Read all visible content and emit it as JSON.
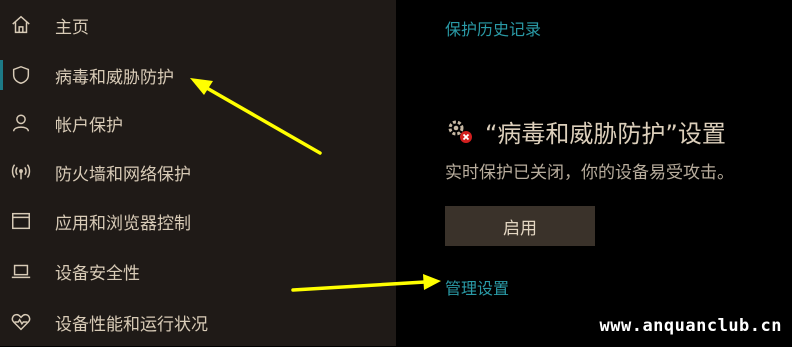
{
  "sidebar": {
    "items": [
      {
        "label": "主页",
        "icon": "home-icon"
      },
      {
        "label": "病毒和威胁防护",
        "icon": "shield-icon",
        "selected": true
      },
      {
        "label": "帐户保护",
        "icon": "person-icon"
      },
      {
        "label": "防火墙和网络保护",
        "icon": "wifi-icon"
      },
      {
        "label": "应用和浏览器控制",
        "icon": "window-icon"
      },
      {
        "label": "设备安全性",
        "icon": "laptop-icon"
      },
      {
        "label": "设备性能和运行状况",
        "icon": "heart-icon"
      }
    ]
  },
  "main": {
    "history_link": "保护历史记录",
    "section_title": "“病毒和威胁防护”设置",
    "status_text": "实时保护已关闭，你的设备易受攻击。",
    "enable_button": "启用",
    "manage_link": "管理设置"
  },
  "watermark": "www.anquanclub.cn",
  "colors": {
    "sidebar_bg": "#1f1a17",
    "main_bg": "#000000",
    "accent": "#2a9aa6",
    "arrow": "#ffff00",
    "button_bg": "#3a322a"
  }
}
